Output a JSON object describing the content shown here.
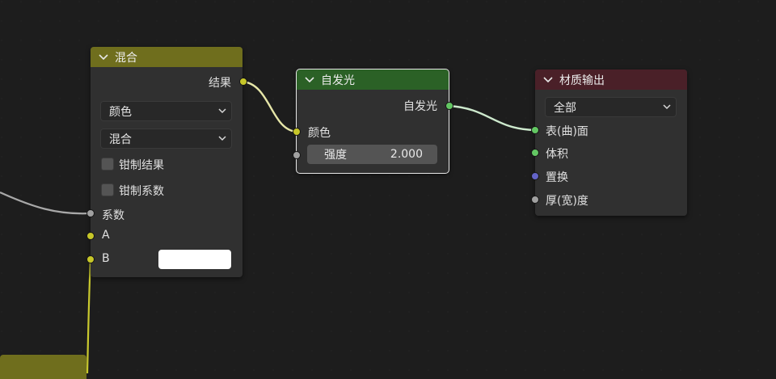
{
  "colors": {
    "background": "#1d1d1d",
    "mix_header": "#6f6e1d",
    "emission_header": "#2b6126",
    "output_header": "#4a2028",
    "socket_color": "#c7c729",
    "socket_float": "#a1a1a1",
    "socket_shader": "#63c763",
    "socket_vector": "#6363c7"
  },
  "nodes": {
    "mix": {
      "title": "混合",
      "output_result": "结果",
      "dropdown_type": "颜色",
      "dropdown_blend": "混合",
      "clamp_result": "钳制结果",
      "clamp_factor": "钳制系数",
      "input_factor": "系数",
      "input_a": "A",
      "input_b": "B"
    },
    "emission": {
      "title": "自发光",
      "output_emission": "自发光",
      "input_color": "颜色",
      "strength_label": "强度",
      "strength_value": "2.000"
    },
    "material_output": {
      "title": "材质输出",
      "target": "全部",
      "input_surface": "表(曲)面",
      "input_volume": "体积",
      "input_displacement": "置换",
      "input_thickness": "厚(宽)度"
    }
  }
}
